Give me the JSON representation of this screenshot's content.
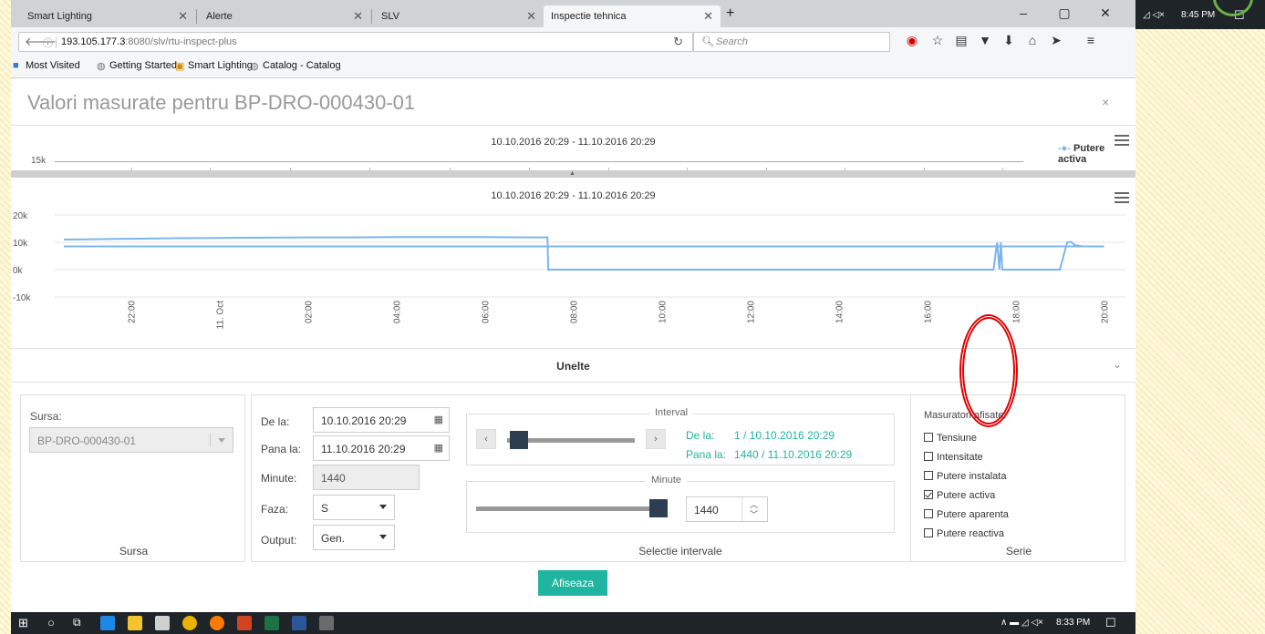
{
  "browser": {
    "tabs": [
      {
        "label": "Smart Lighting"
      },
      {
        "label": "Alerte"
      },
      {
        "label": "SLV"
      },
      {
        "label": "Inspectie tehnica"
      }
    ],
    "new_tab": "+",
    "url_host": "193.105.177.3",
    "url_rest": ":8080/slv/rtu-inspect-plus",
    "search_placeholder": "Search",
    "bookmarks": [
      "Most Visited",
      "Getting Started",
      "Smart Lighting",
      "Catalog - Catalog"
    ]
  },
  "outer_tray": {
    "time": "8:45 PM"
  },
  "page": {
    "title": "Valori masurate pentru BP-DRO-000430-01",
    "close": "×"
  },
  "navigator_chart": {
    "title": "10.10.2016 20:29 - 11.10.2016 20:29",
    "ytick": "15k",
    "legend": "Putere activa"
  },
  "chart_data": {
    "type": "line",
    "title": "10.10.2016 20:29 - 11.10.2016 20:29",
    "yticks": [
      "20k",
      "10k",
      "0k",
      "-10k"
    ],
    "ylim": [
      -10000,
      20000
    ],
    "xticks": [
      "22:00",
      "11. Oct",
      "02:00",
      "04:00",
      "06:00",
      "08:00",
      "10:00",
      "12:00",
      "14:00",
      "16:00",
      "18:00",
      "20:00"
    ],
    "series": [
      {
        "name": "Putere activa",
        "color": "#7cb5ec",
        "x": [
          "20:29",
          "21:00",
          "22:00",
          "23:00",
          "00:00",
          "01:00",
          "02:00",
          "03:00",
          "04:00",
          "05:00",
          "06:00",
          "07:00",
          "07:25",
          "07:26",
          "08:00",
          "10:00",
          "12:00",
          "14:00",
          "16:00",
          "17:30",
          "17:35",
          "17:38",
          "17:40",
          "17:42",
          "17:45",
          "17:50",
          "18:00",
          "19:00",
          "19:10",
          "19:15",
          "19:20",
          "19:30",
          "20:00",
          "20:29"
        ],
        "values": [
          11000,
          11100,
          11300,
          11500,
          11600,
          11700,
          11800,
          11800,
          11900,
          11900,
          11900,
          11800,
          11800,
          0,
          0,
          0,
          0,
          0,
          0,
          0,
          10000,
          0,
          10000,
          0,
          0,
          0,
          0,
          0,
          10000,
          10200,
          9000,
          8500,
          8500,
          8500
        ]
      }
    ],
    "grid": true
  },
  "tools": {
    "header": "Unelte",
    "source": {
      "label": "Sursa:",
      "value": "BP-DRO-000430-01",
      "footer": "Sursa"
    },
    "form": {
      "from_label": "De la:",
      "from_value": "10.10.2016 20:29",
      "to_label": "Pana la:",
      "to_value": "11.10.2016 20:29",
      "minutes_label": "Minute:",
      "minutes_value": "1440",
      "phase_label": "Faza:",
      "phase_value": "S",
      "output_label": "Output:",
      "output_value": "Gen."
    },
    "interval": {
      "legend": "Interval",
      "from_label": "De la:",
      "from_value": "1 / 10.10.2016 20:29",
      "to_label": "Pana la:",
      "to_value": "1440 / 11.10.2016 20:29",
      "minutes_legend": "Minute",
      "minutes_value": "1440",
      "footer": "Selectie intervale"
    },
    "series": {
      "label": "Masuratori afisate:",
      "items": [
        {
          "label": "Tensiune",
          "checked": false
        },
        {
          "label": "Intensitate",
          "checked": false
        },
        {
          "label": "Putere instalata",
          "checked": false
        },
        {
          "label": "Putere activa",
          "checked": true
        },
        {
          "label": "Putere aparenta",
          "checked": false
        },
        {
          "label": "Putere reactiva",
          "checked": false
        }
      ],
      "footer": "Serie"
    },
    "submit": "Afiseaza"
  },
  "taskbar": {
    "time": "8:33 PM"
  },
  "colors": {
    "accent": "#1fb5a0",
    "line": "#7cb5ec",
    "annotation": "#e00000"
  }
}
